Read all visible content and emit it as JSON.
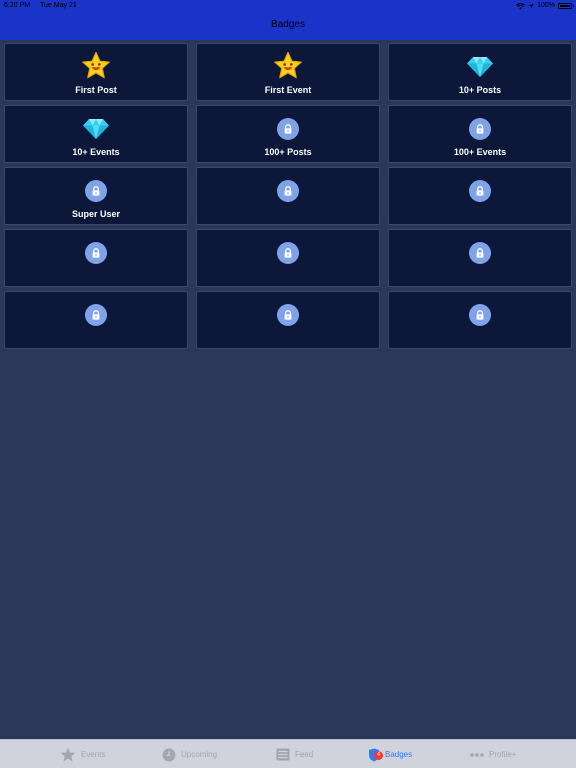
{
  "status_bar": {
    "time": "6:20 PM",
    "date": "Tue May 21",
    "battery": "100%"
  },
  "header": {
    "title": "Badges"
  },
  "badges": [
    {
      "label": "First Post",
      "icon": "star-icon"
    },
    {
      "label": "First Event",
      "icon": "star-icon"
    },
    {
      "label": "10+ Posts",
      "icon": "diamond-icon"
    },
    {
      "label": "10+ Events",
      "icon": "diamond-icon"
    },
    {
      "label": "100+ Posts",
      "icon": "lock-icon"
    },
    {
      "label": "100+ Events",
      "icon": "lock-icon"
    },
    {
      "label": "Super User",
      "icon": "lock-icon"
    },
    {
      "label": "",
      "icon": "lock-icon"
    },
    {
      "label": "",
      "icon": "lock-icon"
    },
    {
      "label": "",
      "icon": "lock-icon"
    },
    {
      "label": "",
      "icon": "lock-icon"
    },
    {
      "label": "",
      "icon": "lock-icon"
    },
    {
      "label": "",
      "icon": "lock-icon"
    },
    {
      "label": "",
      "icon": "lock-icon"
    },
    {
      "label": "",
      "icon": "lock-icon"
    }
  ],
  "tabbar": {
    "tabs": [
      {
        "label": "Events",
        "icon": "star-icon",
        "active": false
      },
      {
        "label": "Upcoming",
        "icon": "clock-icon",
        "active": false
      },
      {
        "label": "Feed",
        "icon": "list-icon",
        "active": false
      },
      {
        "label": "Badges",
        "icon": "shield-icon",
        "active": true,
        "badge_count": "4"
      },
      {
        "label": "Profile+",
        "icon": "more-icon",
        "active": false
      }
    ]
  },
  "colors": {
    "header": "#1a33c9",
    "background": "#2b385c",
    "card": "#0c1739",
    "lock": "#7fa3e9",
    "active_tab": "#2f7cf6",
    "inactive_tab": "#a2a6b2",
    "badge_red": "#f03a31"
  }
}
